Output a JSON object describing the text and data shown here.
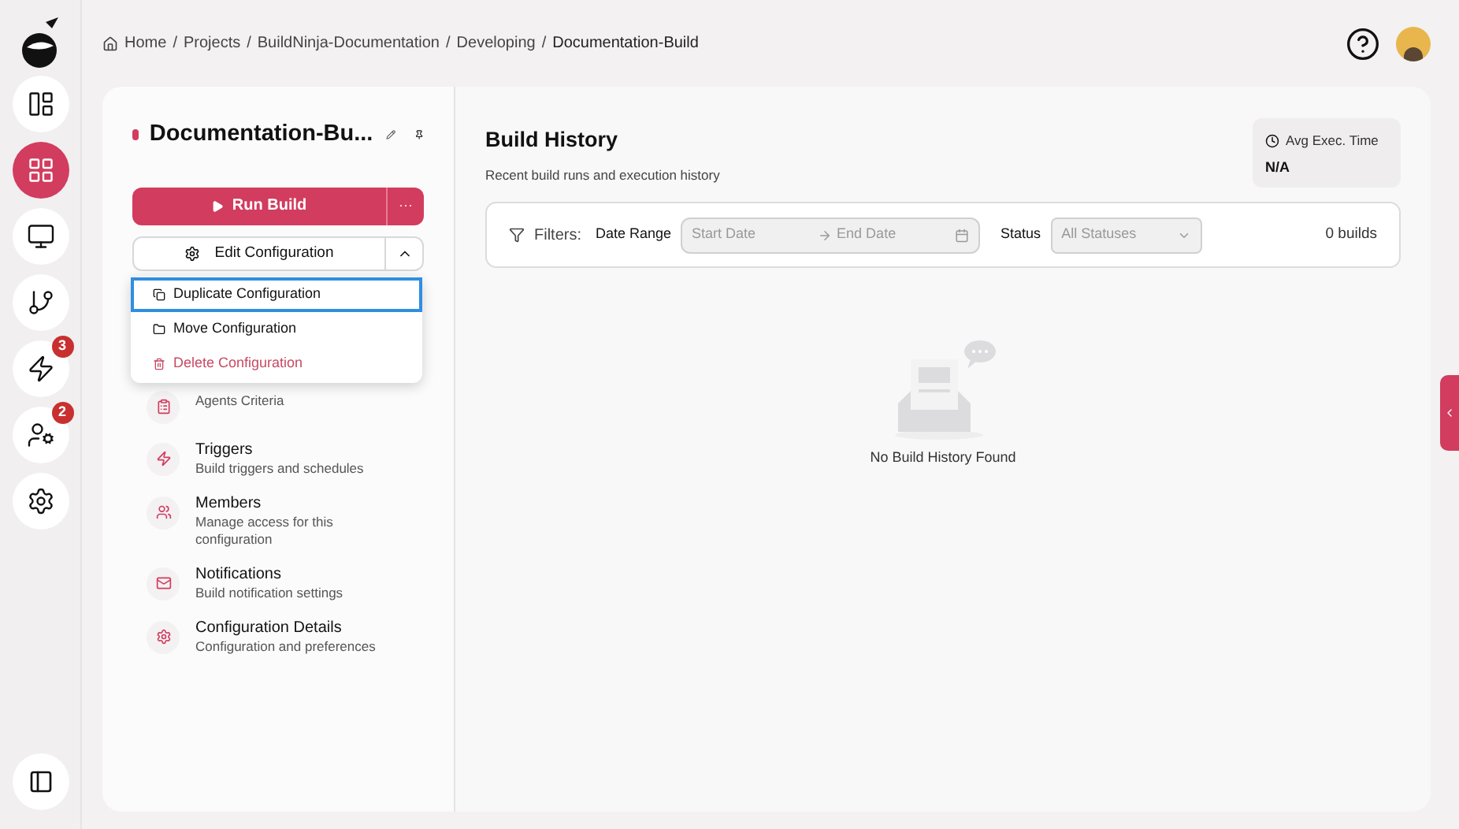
{
  "rail": {
    "items": [
      {
        "selected": false
      },
      {
        "selected": true
      },
      {
        "selected": false
      },
      {
        "selected": false
      },
      {
        "selected": false,
        "badge": "3"
      },
      {
        "selected": false,
        "badge": "2"
      },
      {
        "selected": false
      }
    ]
  },
  "breadcrumb": [
    {
      "kind": "link",
      "text": "Home"
    },
    {
      "kind": "separator",
      "text": "/"
    },
    {
      "kind": "link",
      "text": "Projects"
    },
    {
      "kind": "separator",
      "text": "/"
    },
    {
      "kind": "link",
      "text": "BuildNinja-Documentation"
    },
    {
      "kind": "separator",
      "text": "/"
    },
    {
      "kind": "link",
      "text": "Developing"
    },
    {
      "kind": "separator",
      "text": "/"
    },
    {
      "kind": "current",
      "text": "Documentation-Build"
    }
  ],
  "config": {
    "title": "Documentation-Bu...",
    "run_button": "Run Build",
    "more_button": "···",
    "edit_button": "Edit Configuration",
    "menu_expanded": true,
    "menu": [
      {
        "label": "Duplicate Configuration",
        "selected": true,
        "danger": false
      },
      {
        "label": "Move Configuration",
        "selected": false,
        "danger": false
      },
      {
        "label": "Delete Configuration",
        "selected": false,
        "danger": true
      }
    ],
    "sections": [
      {
        "description": "Agents Criteria"
      },
      {
        "title": "Triggers",
        "description": "Build triggers and schedules"
      },
      {
        "title": "Members",
        "description": "Manage access for this configuration"
      },
      {
        "title": "Notifications",
        "description": "Build notification settings"
      },
      {
        "title": "Configuration Details",
        "description": "Configuration and preferences"
      }
    ]
  },
  "history": {
    "title": "Build History",
    "subtitle": "Recent build runs and execution history",
    "avg_label": "Avg Exec. Time",
    "avg_value": "N/A",
    "filters": {
      "label": "Filters:",
      "date_label": "Date Range",
      "start_placeholder": "Start Date",
      "end_placeholder": "End Date",
      "status_label": "Status",
      "status_value": "All Statuses",
      "count": "0 builds"
    },
    "empty": "No Build History Found"
  }
}
